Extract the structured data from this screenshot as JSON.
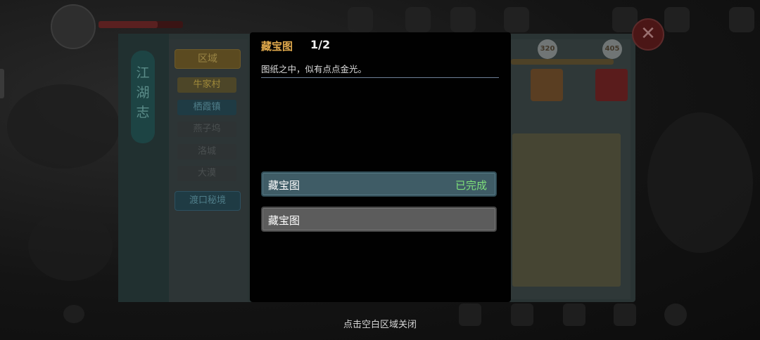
{
  "popup": {
    "title": "藏宝图",
    "count": "1/2",
    "description": "图纸之中，似有点点金光。",
    "steps": [
      {
        "label": "藏宝图",
        "status": "已完成"
      },
      {
        "label": "藏宝图",
        "status": ""
      }
    ]
  },
  "close_hint": "点击空白区域关闭",
  "book": {
    "vertical_title": "江湖志",
    "region_header": "区域",
    "regions": [
      "牛家村",
      "栖霞镇",
      "燕子坞",
      "洛城",
      "大漠"
    ],
    "secret_area": "渡口秘境",
    "scores": [
      "320",
      "405"
    ]
  },
  "colors": {
    "title_gold": "#e0a94c",
    "completed_green": "#7ee07a",
    "done_step_bg": "#3f5c66",
    "todo_step_bg": "#5c5c5c",
    "close_button_red": "#4b1616"
  },
  "icons": {
    "close": "close-icon",
    "chat": "chat-icon",
    "check": "check-icon"
  }
}
